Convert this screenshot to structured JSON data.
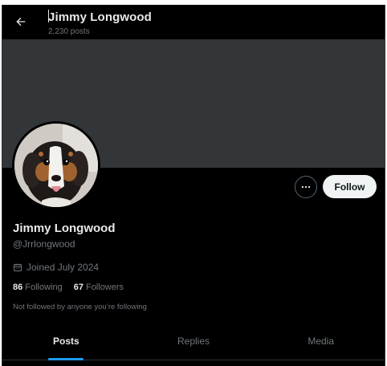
{
  "header": {
    "name": "Jimmy Longwood",
    "post_count": "2,230 posts"
  },
  "profile": {
    "display_name": "Jimmy Longwood",
    "handle": "@Jrrlongwood",
    "joined": "Joined July 2024",
    "following_count": "86",
    "following_label": "Following",
    "followers_count": "67",
    "followers_label": "Followers",
    "not_followed_text": "Not followed by anyone you’re following"
  },
  "actions": {
    "follow_label": "Follow",
    "more_icon": "ellipsis-icon"
  },
  "tabs": [
    {
      "label": "Posts",
      "active": true
    },
    {
      "label": "Replies",
      "active": false
    },
    {
      "label": "Media",
      "active": false
    }
  ],
  "colors": {
    "accent": "#1d9bf0",
    "background": "#000000",
    "banner": "#333639",
    "muted": "#71767b"
  }
}
